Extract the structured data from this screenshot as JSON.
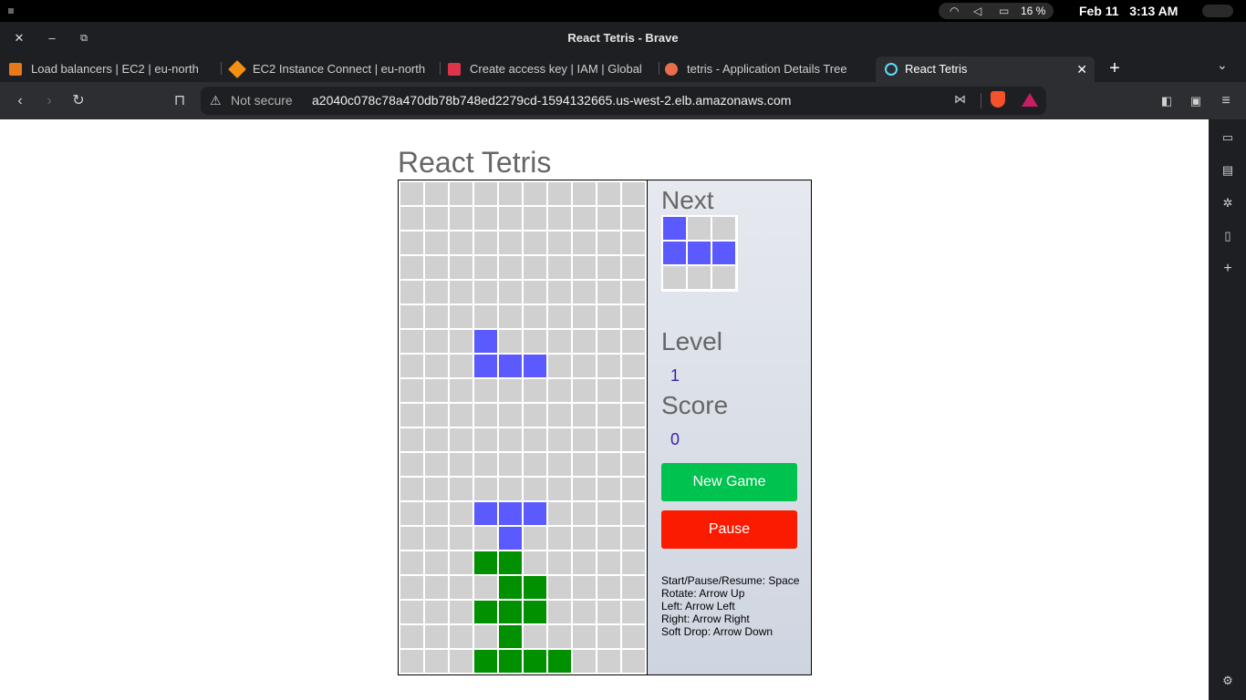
{
  "system": {
    "battery": "16 %",
    "date": "Feb 11",
    "time": "3:13 AM"
  },
  "window": {
    "title": "React Tetris - Brave"
  },
  "tabs": [
    {
      "label": "Load balancers | EC2 | eu-north",
      "color": "#e8781a"
    },
    {
      "label": "EC2 Instance Connect | eu-north",
      "color": "#f29111"
    },
    {
      "label": "Create access key | IAM | Global",
      "color": "#dd344c"
    },
    {
      "label": "tetris - Application Details Tree",
      "color": "#e96d4c"
    },
    {
      "label": "React Tetris",
      "color": "#61dafb",
      "active": true
    }
  ],
  "nav": {
    "security_label": "Not secure",
    "url": "a2040c078c78a470db78b748ed2279cd-1594132665.us-west-2.elb.amazonaws.com"
  },
  "app": {
    "title": "React Tetris",
    "board": {
      "cols": 10,
      "rows": 20,
      "filled": [
        {
          "row": 6,
          "col": 3,
          "color": "#5a5aff"
        },
        {
          "row": 7,
          "col": 3,
          "color": "#5a5aff"
        },
        {
          "row": 7,
          "col": 4,
          "color": "#5a5aff"
        },
        {
          "row": 7,
          "col": 5,
          "color": "#5a5aff"
        },
        {
          "row": 13,
          "col": 3,
          "color": "#5a5aff"
        },
        {
          "row": 13,
          "col": 4,
          "color": "#5a5aff"
        },
        {
          "row": 13,
          "col": 5,
          "color": "#5a5aff"
        },
        {
          "row": 14,
          "col": 4,
          "color": "#5a5aff"
        },
        {
          "row": 15,
          "col": 3,
          "color": "#009000"
        },
        {
          "row": 15,
          "col": 4,
          "color": "#009000"
        },
        {
          "row": 16,
          "col": 4,
          "color": "#009000"
        },
        {
          "row": 16,
          "col": 5,
          "color": "#009000"
        },
        {
          "row": 17,
          "col": 3,
          "color": "#009000"
        },
        {
          "row": 17,
          "col": 4,
          "color": "#009000"
        },
        {
          "row": 17,
          "col": 5,
          "color": "#009000"
        },
        {
          "row": 18,
          "col": 4,
          "color": "#009000"
        },
        {
          "row": 19,
          "col": 3,
          "color": "#009000"
        },
        {
          "row": 19,
          "col": 4,
          "color": "#009000"
        },
        {
          "row": 19,
          "col": 5,
          "color": "#009000"
        },
        {
          "row": 19,
          "col": 6,
          "color": "#009000"
        }
      ]
    },
    "next": {
      "label": "Next",
      "filled": [
        {
          "row": 0,
          "col": 0,
          "color": "#5a5aff"
        },
        {
          "row": 1,
          "col": 0,
          "color": "#5a5aff"
        },
        {
          "row": 1,
          "col": 1,
          "color": "#5a5aff"
        },
        {
          "row": 1,
          "col": 2,
          "color": "#5a5aff"
        }
      ]
    },
    "level_label": "Level",
    "level": "1",
    "score_label": "Score",
    "score": "0",
    "new_game_label": "New Game",
    "pause_label": "Pause",
    "help": [
      "Start/Pause/Resume: Space",
      "Rotate: Arrow Up",
      "Left: Arrow Left",
      "Right: Arrow Right",
      "Soft Drop: Arrow Down"
    ]
  }
}
